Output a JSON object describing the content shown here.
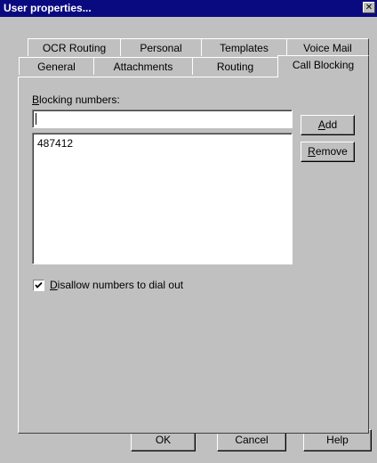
{
  "window": {
    "title": "User properties..."
  },
  "tabs": {
    "row_back": [
      "OCR Routing",
      "Personal",
      "Templates",
      "Voice Mail"
    ],
    "row_front": [
      "General",
      "Attachments",
      "Routing",
      "Call Blocking"
    ]
  },
  "call_blocking": {
    "blocking_label_first": "B",
    "blocking_label_rest": "locking numbers:",
    "input_value": "",
    "numbers": [
      "487412"
    ],
    "add_first": "A",
    "add_rest": "dd",
    "remove_first": "R",
    "remove_rest": "emove",
    "disallow_first": "D",
    "disallow_rest": "isallow numbers to dial out",
    "disallow_checked": true
  },
  "buttons": {
    "ok": "OK",
    "cancel": "Cancel",
    "help": "Help"
  }
}
